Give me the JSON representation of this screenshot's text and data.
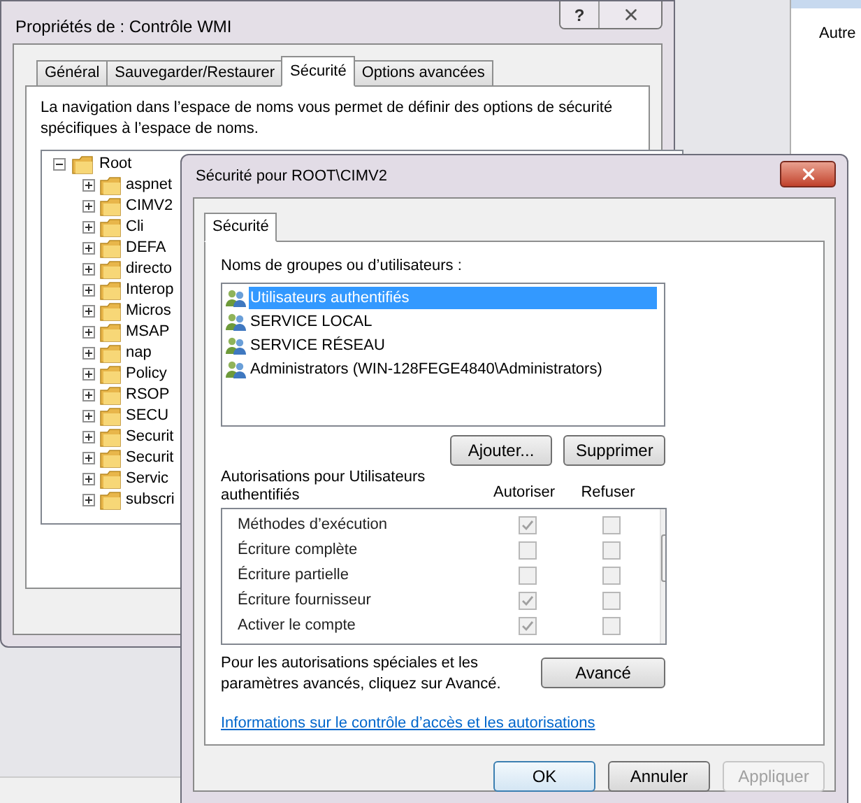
{
  "background_window": {
    "label": "Autre"
  },
  "properties_window": {
    "title": "Propriétés de : Contrôle WMI",
    "help_button": "?",
    "tabs": [
      {
        "label": "Général",
        "selected": false
      },
      {
        "label": "Sauvegarder/Restaurer",
        "selected": false
      },
      {
        "label": "Sécurité",
        "selected": true
      },
      {
        "label": "Options avancées",
        "selected": false
      }
    ],
    "description": "La navigation dans l’espace de noms vous permet de définir des options de sécurité spécifiques à l’espace de noms.",
    "tree": {
      "label": "Root",
      "expanded": true,
      "children": [
        {
          "label": "aspnet",
          "expanded": false
        },
        {
          "label": "CIMV2",
          "expanded": false
        },
        {
          "label": "Cli",
          "expanded": false
        },
        {
          "label": "DEFA",
          "expanded": false
        },
        {
          "label": "directo",
          "expanded": false
        },
        {
          "label": "Interop",
          "expanded": false
        },
        {
          "label": "Micros",
          "expanded": false
        },
        {
          "label": "MSAP",
          "expanded": false
        },
        {
          "label": "nap",
          "expanded": false
        },
        {
          "label": "Policy",
          "expanded": false
        },
        {
          "label": "RSOP",
          "expanded": false
        },
        {
          "label": "SECU",
          "expanded": false
        },
        {
          "label": "Securit",
          "expanded": false
        },
        {
          "label": "Securit",
          "expanded": false
        },
        {
          "label": "Servic",
          "expanded": false
        },
        {
          "label": "subscri",
          "expanded": false
        }
      ]
    }
  },
  "security_dialog": {
    "title": "Sécurité pour ROOT\\CIMV2",
    "tabs": [
      {
        "label": "Sécurité",
        "selected": true
      }
    ],
    "users_label": "Noms de groupes ou d’utilisateurs :",
    "users": [
      {
        "name": "Utilisateurs authentifiés",
        "selected": true
      },
      {
        "name": "SERVICE LOCAL",
        "selected": false
      },
      {
        "name": "SERVICE RÉSEAU",
        "selected": false
      },
      {
        "name": "Administrators (WIN-128FEGE4840\\Administrators)",
        "selected": false
      }
    ],
    "add_button": "Ajouter...",
    "remove_button": "Supprimer",
    "permissions_label": "Autorisations pour Utilisateurs authentifiés",
    "columns": [
      "Autoriser",
      "Refuser"
    ],
    "permissions": [
      {
        "name": "Méthodes d’exécution",
        "allow": true,
        "deny": false,
        "disabled": true
      },
      {
        "name": "Écriture complète",
        "allow": false,
        "deny": false,
        "disabled": true
      },
      {
        "name": "Écriture partielle",
        "allow": false,
        "deny": false,
        "disabled": true
      },
      {
        "name": "Écriture fournisseur",
        "allow": true,
        "deny": false,
        "disabled": true
      },
      {
        "name": "Activer le compte",
        "allow": true,
        "deny": false,
        "disabled": true
      }
    ],
    "advanced_text": "Pour les autorisations spéciales et les paramètres avancés, cliquez sur Avancé.",
    "advanced_button": "Avancé",
    "link": "Informations sur le contrôle d’accès et les autorisations",
    "buttons": [
      {
        "label": "OK",
        "default": true,
        "disabled": false
      },
      {
        "label": "Annuler",
        "default": false,
        "disabled": false
      },
      {
        "label": "Appliquer",
        "default": false,
        "disabled": true
      }
    ]
  }
}
